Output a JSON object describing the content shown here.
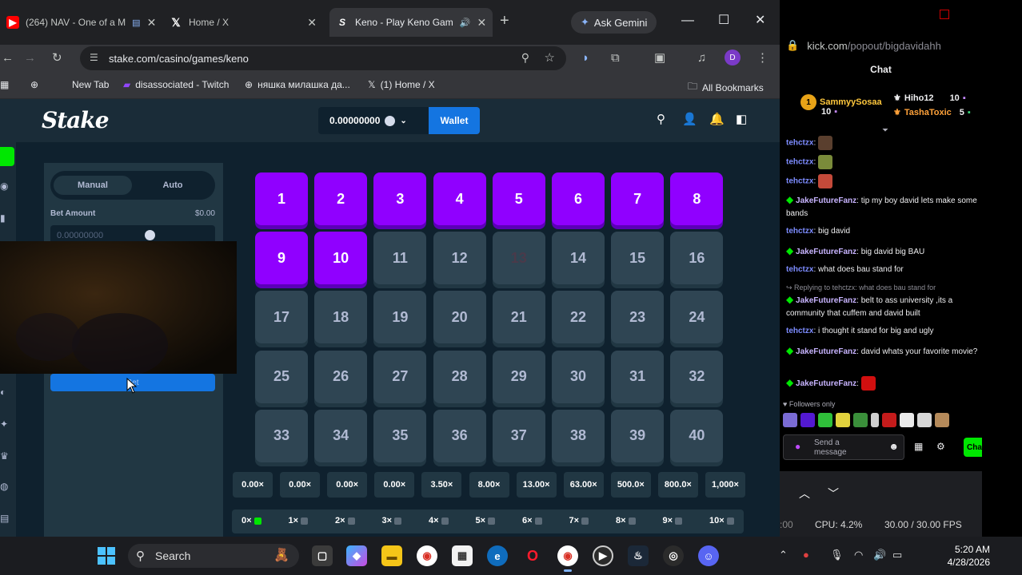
{
  "browser": {
    "tabs": [
      {
        "label": "(264) NAV - One of a M",
        "icon": "youtube-icon"
      },
      {
        "label": "Home / X",
        "icon": "x-icon"
      },
      {
        "label": "Keno - Play Keno Gam",
        "icon": "stake-icon"
      }
    ],
    "gemini_label": "Ask Gemini",
    "url": "stake.com/casino/games/keno",
    "bookmarks": [
      {
        "label": "New Tab",
        "icon": ""
      },
      {
        "label": "disassociated - Twitch",
        "icon": "twitch-icon"
      },
      {
        "label": "няшка милашка да...",
        "icon": "globe-icon"
      },
      {
        "label": "(1) Home / X",
        "icon": "x-icon"
      }
    ],
    "all_bookmarks_label": "All Bookmarks",
    "profile_initial": "D"
  },
  "stake": {
    "logo": "Stake",
    "balance": "0.00000000",
    "wallet_label": "Wallet",
    "mode_manual": "Manual",
    "mode_auto": "Auto",
    "bet_amount_label": "Bet Amount",
    "bet_amount_usd": "$0.00",
    "bet_amount_value": "0.00000000",
    "bet_button_label": "Bet",
    "tiles": [
      "1",
      "2",
      "3",
      "4",
      "5",
      "6",
      "7",
      "8",
      "9",
      "10",
      "11",
      "12",
      "13",
      "14",
      "15",
      "16",
      "17",
      "18",
      "19",
      "20",
      "21",
      "22",
      "23",
      "24",
      "25",
      "26",
      "27",
      "28",
      "29",
      "30",
      "31",
      "32",
      "33",
      "34",
      "35",
      "36",
      "37",
      "38",
      "39",
      "40"
    ],
    "selected_count": 10,
    "multipliers": [
      "0.00×",
      "0.00×",
      "0.00×",
      "0.00×",
      "3.50×",
      "8.00×",
      "13.00×",
      "63.00×",
      "500.0×",
      "800.0×",
      "1,000×"
    ],
    "hits": [
      "0×",
      "1×",
      "2×",
      "3×",
      "4×",
      "5×",
      "6×",
      "7×",
      "8×",
      "9×",
      "10×"
    ],
    "colors": {
      "selected": "#9000ff",
      "tile": "#2f4553",
      "wallet": "#1475e1",
      "hit_gem": "#00e701"
    }
  },
  "chat": {
    "url_host": "kick.com",
    "url_path": "/popout/bigdavidahh",
    "title": "Chat",
    "leaderboard": {
      "first_name": "SammyySosaa",
      "first_count": "10",
      "second_name": "Hiho12",
      "second_count": "10",
      "third_name": "TashaToxic",
      "third_count": "5"
    },
    "messages": [
      {
        "user": "tehctzx",
        "text": "",
        "badge": false
      },
      {
        "user": "tehctzx",
        "text": "",
        "badge": false
      },
      {
        "user": "tehctzx",
        "text": "",
        "badge": false
      },
      {
        "user": "JakeFutureFanz",
        "text": "tip my boy david lets make some bands",
        "badge": true
      },
      {
        "user": "tehctzx",
        "text": "big david",
        "badge": false
      },
      {
        "user": "JakeFutureFanz",
        "text": "big david big BAU",
        "badge": true
      },
      {
        "user": "tehctzx",
        "text": "what does bau stand for",
        "badge": false
      },
      {
        "user": "JakeFutureFanz",
        "text": "belt to ass university ,its a community that cuffem and david built",
        "badge": true
      },
      {
        "user": "tehctzx",
        "text": "i thought it stand for big and ugly",
        "badge": false
      },
      {
        "user": "JakeFutureFanz",
        "text": "david whats your favorite movie?",
        "badge": true
      },
      {
        "user": "JakeFutureFanz",
        "text": "",
        "badge": true
      }
    ],
    "reply_note": "Replying to tehctzx: what does bau stand for",
    "followers_only": "Followers only",
    "input_placeholder_line1": "Send a",
    "input_placeholder_line2": "message",
    "send_label": "Chat"
  },
  "obs": {
    "time": ":00",
    "cpu": "CPU: 4.2%",
    "fps": "30.00 / 30.00 FPS"
  },
  "taskbar": {
    "search_label": "Search",
    "time": "5:20 AM",
    "date": "4/28/2026"
  }
}
